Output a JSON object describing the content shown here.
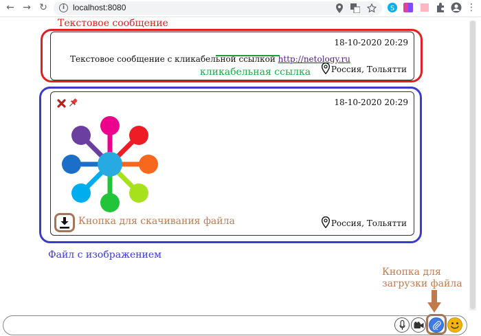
{
  "browser": {
    "url": "localhost:8080"
  },
  "annotations": {
    "text_message": "Текстовое сообщение",
    "clickable_link": "кликабельная ссылка",
    "download_button": "Кнопка для скачивания файла",
    "image_file": "Файл с изображением",
    "upload_button_line1": "Кнопка для",
    "upload_button_line2": "загрузки файла"
  },
  "messages": [
    {
      "date": "18-10-2020 20:29",
      "text": "Текстовое сообщение с кликабельной ссылкой ",
      "link": "http://netology.ru",
      "location": "Россия, Тольятти"
    },
    {
      "date": "18-10-2020 20:29",
      "location": "Россия, Тольятти",
      "image_icon": "color-spoke-image",
      "actions": [
        "delete-icon",
        "pin-icon"
      ]
    }
  ],
  "input_icons": [
    "microphone-icon",
    "video-camera-icon",
    "attach-icon",
    "emoji-icon"
  ],
  "colors": {
    "text_frame": "#e02020",
    "image_frame": "#3b3bd0",
    "link_underline": "#1c9a3c",
    "annotation_brown": "#c07a4d",
    "link_label": "#22a845",
    "image_label": "#3b3bd0"
  }
}
